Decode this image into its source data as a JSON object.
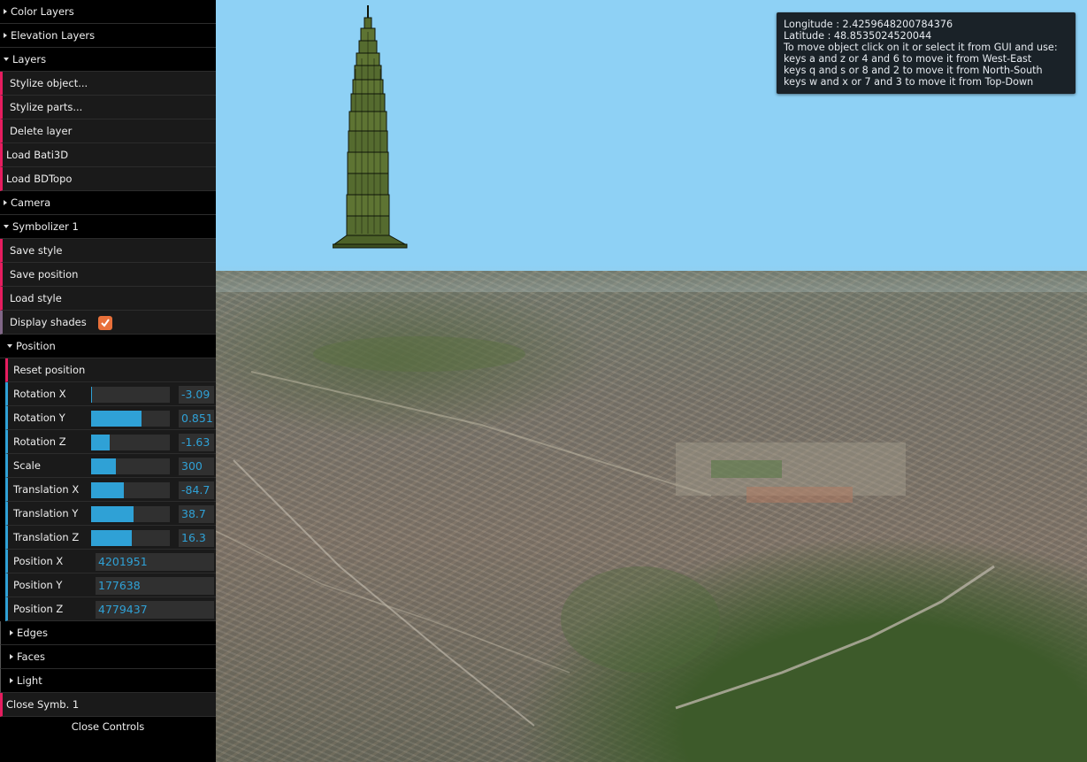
{
  "gui": {
    "folders": {
      "color_layers": "Color Layers",
      "elevation_layers": "Elevation Layers",
      "layers": "Layers",
      "camera": "Camera",
      "symbolizer": "Symbolizer 1",
      "position": "Position",
      "edges": "Edges",
      "faces": "Faces",
      "light": "Light"
    },
    "layers_items": {
      "stylize_object": "Stylize object...",
      "stylize_parts": "Stylize parts...",
      "delete_layer": "Delete layer"
    },
    "load_bati3d": "Load Bati3D",
    "load_bdtopo": "Load BDTopo",
    "symbolizer_items": {
      "save_style": "Save style",
      "save_position": "Save position",
      "load_style": "Load style",
      "display_shades": "Display shades",
      "display_shades_checked": true
    },
    "position_items": {
      "reset_position": "Reset position",
      "rotation_x": {
        "label": "Rotation X",
        "value": "-3.09",
        "fill": 0.01
      },
      "rotation_y": {
        "label": "Rotation Y",
        "value": "0.851",
        "fill": 0.64
      },
      "rotation_z": {
        "label": "Rotation Z",
        "value": "-1.63",
        "fill": 0.24
      },
      "scale": {
        "label": "Scale",
        "value": "300",
        "fill": 0.31
      },
      "translation_x": {
        "label": "Translation X",
        "value": "-84.7",
        "fill": 0.42
      },
      "translation_y": {
        "label": "Translation Y",
        "value": "38.7",
        "fill": 0.54
      },
      "translation_z": {
        "label": "Translation Z",
        "value": "16.3",
        "fill": 0.52
      },
      "position_x": {
        "label": "Position X",
        "value": "4201951"
      },
      "position_y": {
        "label": "Position Y",
        "value": "177638"
      },
      "position_z": {
        "label": "Position Z",
        "value": "4779437"
      }
    },
    "close_symb": "Close Symb. 1",
    "close_controls": "Close Controls"
  },
  "info": {
    "longitude": "Longitude : 2.4259648200784376",
    "latitude": "Latitude : 48.8535024520044",
    "line1": "To move object click on it or select it from GUI and use:",
    "line2": "keys a and z or 4 and 6 to move it from West-East",
    "line3": "keys q and s or 8 and 2 to move it from North-South",
    "line4": "keys w and x or 7 and 3 to move it from Top-Down"
  },
  "colors": {
    "function_accent": "#e61d5f",
    "number_accent": "#2fa1d6",
    "boolean_accent": "#806787",
    "checkbox": "#e8703a",
    "sky": "#8ed1f5"
  }
}
